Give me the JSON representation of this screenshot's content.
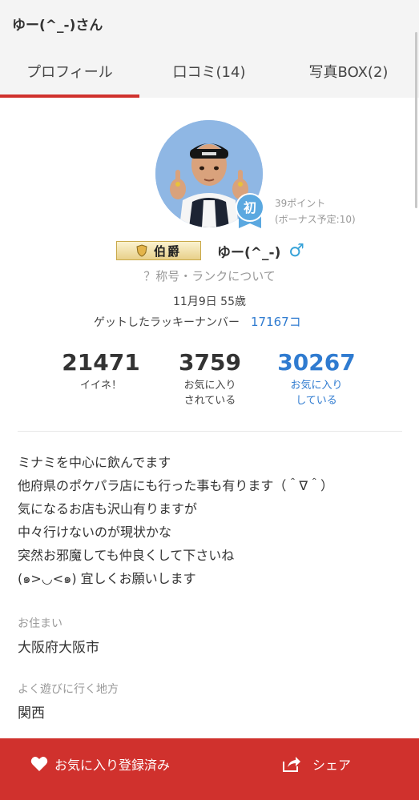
{
  "header": {
    "title": "ゆー(^_-)さん"
  },
  "tabs": [
    {
      "label": "プロフィール",
      "active": true
    },
    {
      "label": "口コミ(14)",
      "active": false
    },
    {
      "label": "写真BOX(2)",
      "active": false
    }
  ],
  "profile": {
    "points_label": "39ポイント",
    "bonus_label": "(ボーナス予定:10)",
    "first_badge": "初",
    "rank": "伯爵",
    "name": "ゆー(^_-)",
    "gender_icon": "♂",
    "rank_link": "？称号・ランクについて",
    "birth": "11月9日 55歳",
    "lucky_label": "ゲットしたラッキーナンバー",
    "lucky_value": "17167コ"
  },
  "stats": [
    {
      "value": "21471",
      "label1": "イイネ！",
      "label2": ""
    },
    {
      "value": "3759",
      "label1": "お気に入り",
      "label2": "されている"
    },
    {
      "value": "30267",
      "label1": "お気に入り",
      "label2": "している"
    }
  ],
  "bio": [
    "ミナミを中心に飲んでます",
    "他府県のポケパラ店にも行った事も有ります（＾∇＾）",
    "気になるお店も沢山有りますが",
    "中々行けないのが現状かな",
    "突然お邪魔しても仲良くして下さいね",
    "(๑>◡<๑) 宜しくお願いします"
  ],
  "residence": {
    "label": "お住まい",
    "value": "大阪府大阪市"
  },
  "hangout": {
    "label": "よく遊びに行く地方",
    "value": "関西"
  },
  "bottom": {
    "favorite_label": "お気に入り登録済み",
    "share_label": "シェア"
  },
  "colors": {
    "accent": "#d0312d",
    "link": "#2f7bd0",
    "male": "#36a2d8",
    "avatar_bg": "#8fb7e4"
  }
}
